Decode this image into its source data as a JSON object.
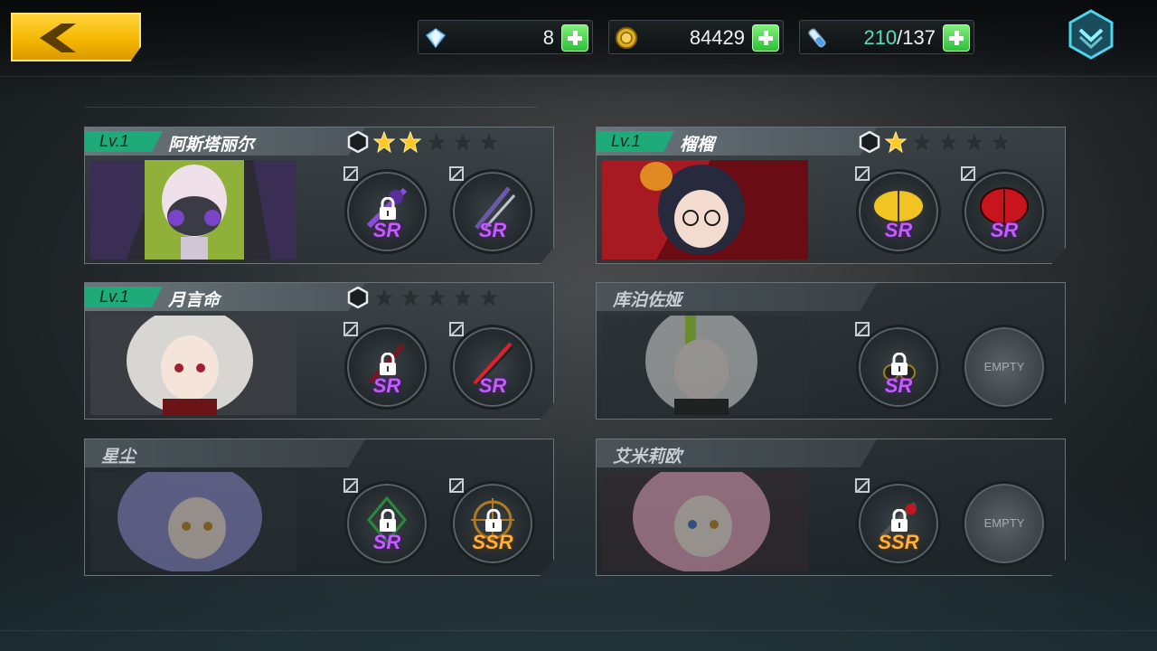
{
  "resources": {
    "diamonds": "8",
    "gold": "84429",
    "stamina_current": "210",
    "stamina_sep_max": "/137"
  },
  "icons": {
    "back": "chevron-left-icon",
    "diamond": "diamond-icon",
    "gold": "gold-coin-icon",
    "stamina": "stamina-vial-icon",
    "add": "plus-icon",
    "menu": "chevron-down-menu-icon",
    "lock": "lock-icon"
  },
  "colors": {
    "level_badge": "#1faa7a",
    "sr": "#c45cff",
    "ssr": "#ffb03a",
    "back_button": "#f4b400"
  },
  "team": [
    {
      "level": "Lv.1",
      "name": "阿斯塔丽尔",
      "stars": 2,
      "max_stars": 5,
      "unlocked": true,
      "weapons": [
        {
          "rank": "SR",
          "locked": true,
          "empty": false
        },
        {
          "rank": "SR",
          "locked": false,
          "empty": false
        }
      ]
    },
    {
      "level": "Lv.1",
      "name": "榴榴",
      "stars": 1,
      "max_stars": 5,
      "unlocked": true,
      "weapons": [
        {
          "rank": "SR",
          "locked": false,
          "empty": false
        },
        {
          "rank": "SR",
          "locked": false,
          "empty": false
        }
      ]
    },
    {
      "level": "Lv.1",
      "name": "月言命",
      "stars": 0,
      "max_stars": 5,
      "unlocked": true,
      "weapons": [
        {
          "rank": "SR",
          "locked": true,
          "empty": false
        },
        {
          "rank": "SR",
          "locked": false,
          "empty": false
        }
      ]
    },
    {
      "level": "",
      "name": "库泊佐娅",
      "stars": 0,
      "max_stars": 0,
      "unlocked": false,
      "weapons": [
        {
          "rank": "SR",
          "locked": true,
          "empty": false
        },
        {
          "rank": "",
          "locked": false,
          "empty": true,
          "empty_label": "EMPTY"
        }
      ]
    },
    {
      "level": "",
      "name": "星尘",
      "stars": 0,
      "max_stars": 0,
      "unlocked": false,
      "weapons": [
        {
          "rank": "SR",
          "locked": true,
          "empty": false
        },
        {
          "rank": "SSR",
          "locked": true,
          "empty": false
        }
      ]
    },
    {
      "level": "",
      "name": "艾米莉欧",
      "stars": 0,
      "max_stars": 0,
      "unlocked": false,
      "weapons": [
        {
          "rank": "SSR",
          "locked": true,
          "empty": false
        },
        {
          "rank": "",
          "locked": false,
          "empty": true,
          "empty_label": "EMPTY"
        }
      ]
    }
  ]
}
